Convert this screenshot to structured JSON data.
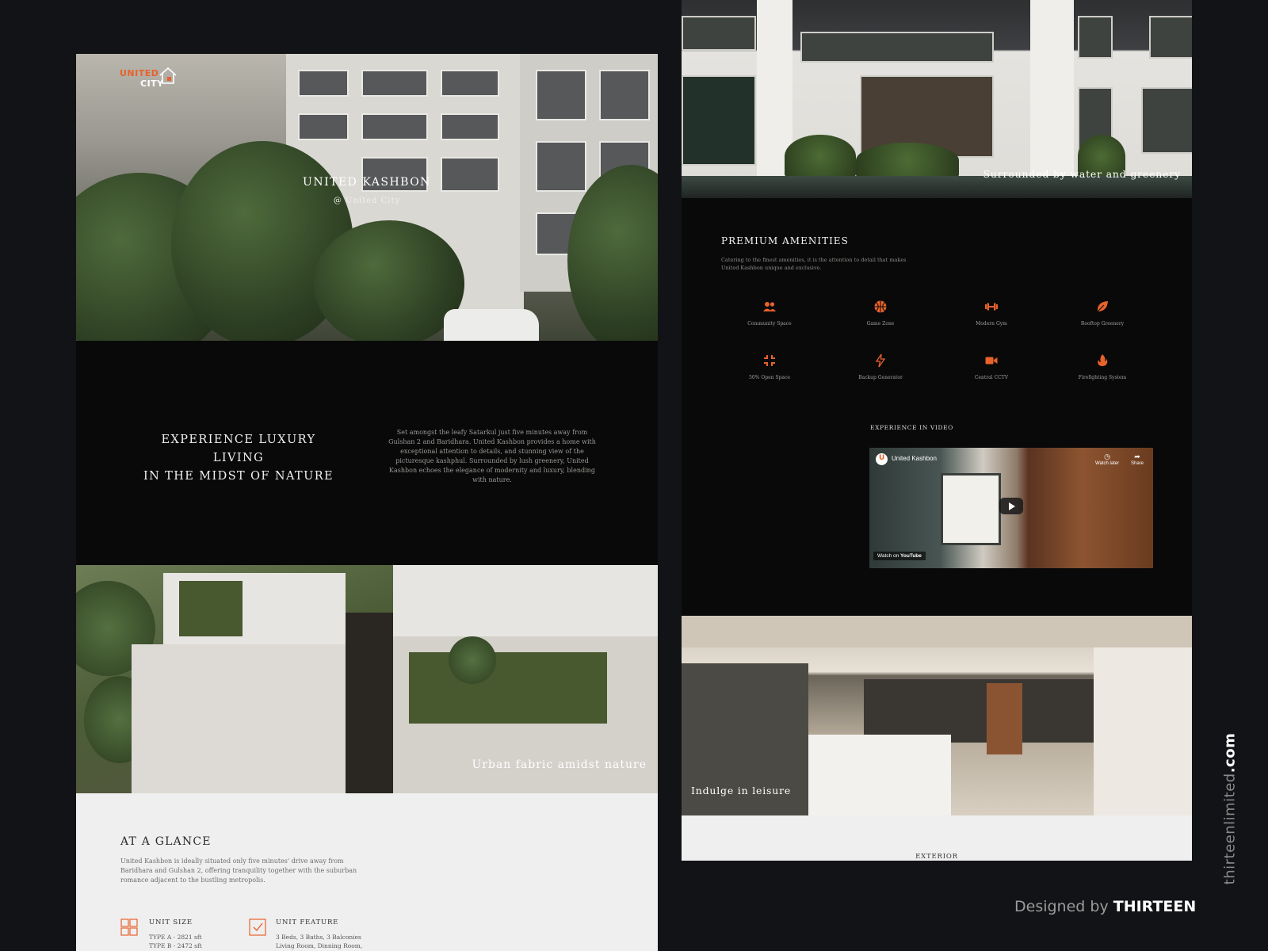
{
  "logo": {
    "line1": "UNITED",
    "line2": "CITY"
  },
  "hero": {
    "title": "UNITED KASHBON",
    "subtitle": "@ United City"
  },
  "intro": {
    "heading_line1": "EXPERIENCE LUXURY LIVING",
    "heading_line2": "IN THE MIDST OF NATURE",
    "paragraph": "Set amongst the leafy Satarkul just five minutes away from Gulshan 2 and Baridhara. United Kashbon provides a home with exceptional attention to details, and stunning view of the picturesque kashphul. Surrounded by lush greenery, United Kashbon echoes the elegance of modernity and luxury, blending with nature."
  },
  "aerial": {
    "caption": "Urban fabric amidst nature"
  },
  "glance": {
    "heading": "AT A GLANCE",
    "paragraph": "United Kashbon is ideally situated only five minutes' drive away from Baridhara and Gulshan 2, offering tranquility together with the suburban romance adjacent to the bustling metropolis.",
    "unit_size": {
      "label": "UNIT SIZE",
      "line1": "TYPE A - 2821 sft",
      "line2": "TYPE B - 2472 sft"
    },
    "unit_feature": {
      "label": "UNIT FEATURE",
      "line1": "3 Beds, 3 Baths, 3 Balconies",
      "line2": "Living Room, Dinning Room,"
    }
  },
  "lobby": {
    "caption": "Surrounded by water and greenery"
  },
  "amenities": {
    "heading": "PREMIUM AMENITIES",
    "paragraph": "Catering to the finest amenities, it is the attention to detail that makes United Kashbon unique and exclusive.",
    "accent": "#e8622c",
    "items": [
      {
        "label": "Community Space",
        "icon": "people-icon"
      },
      {
        "label": "Game Zone",
        "icon": "basketball-icon"
      },
      {
        "label": "Modern Gym",
        "icon": "dumbbell-icon"
      },
      {
        "label": "Rooftop Greenery",
        "icon": "leaf-icon"
      },
      {
        "label": "50% Open Space",
        "icon": "compress-icon"
      },
      {
        "label": "Backup Generator",
        "icon": "bolt-icon"
      },
      {
        "label": "Central CCTV",
        "icon": "video-camera-icon"
      },
      {
        "label": "Firefighting System",
        "icon": "fire-icon"
      }
    ]
  },
  "video": {
    "heading": "EXPERIENCE IN VIDEO",
    "channel_logo": "U",
    "title": "United Kashbon",
    "watch_later": "Watch later",
    "share": "Share",
    "watch_on": "Watch on",
    "platform": "YouTube"
  },
  "interior": {
    "caption": "Indulge in leisure"
  },
  "exterior": {
    "label": "EXTERIOR"
  },
  "credit": {
    "prefix": "Designed by",
    "brand": "THIRTEEN"
  },
  "side_url": {
    "name": "thirteenlimited",
    "tld": ".com"
  }
}
